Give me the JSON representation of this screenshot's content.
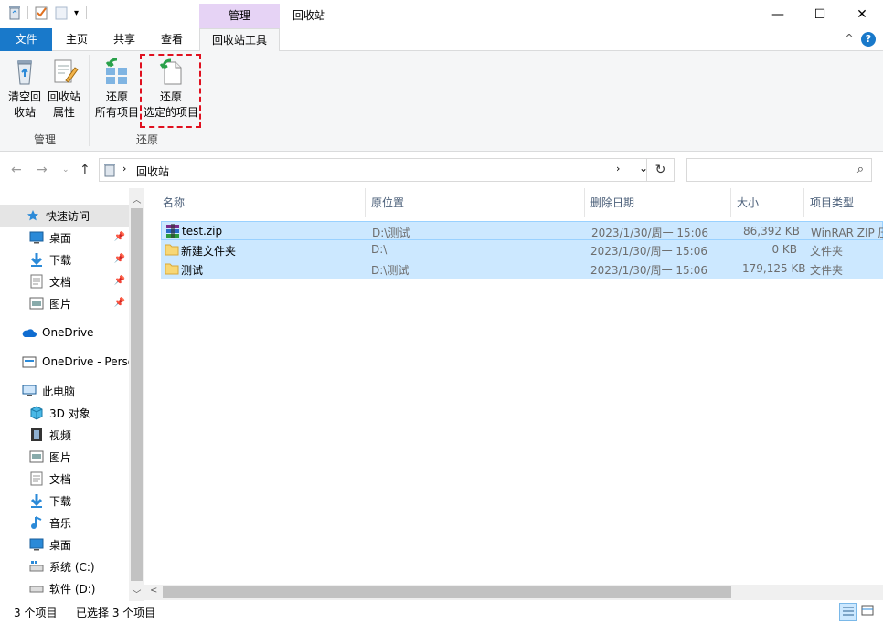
{
  "window": {
    "context_tab": "管理",
    "title": "回收站",
    "minimize": "—",
    "maximize": "☐",
    "close": "✕"
  },
  "ribbon_tabs": {
    "file": "文件",
    "home": "主页",
    "share": "共享",
    "view": "查看",
    "tools": "回收站工具",
    "collapse": "^",
    "help": "?"
  },
  "ribbon": {
    "empty_bin_l1": "清空回",
    "empty_bin_l2": "收站",
    "props_l1": "回收站",
    "props_l2": "属性",
    "group_manage": "管理",
    "restore_all_l1": "还原",
    "restore_all_l2": "所有项目",
    "restore_sel_l1": "还原",
    "restore_sel_l2": "选定的项目",
    "group_restore": "还原"
  },
  "address": {
    "path": "回收站",
    "search_placeholder": ""
  },
  "nav": {
    "quick_access": "快速访问",
    "desktop": "桌面",
    "downloads": "下载",
    "documents": "文档",
    "pictures": "图片",
    "onedrive": "OneDrive",
    "onedrive_personal": "OneDrive - Perso",
    "this_pc": "此电脑",
    "objects3d": "3D 对象",
    "videos": "视频",
    "pictures2": "图片",
    "documents2": "文档",
    "downloads2": "下载",
    "music": "音乐",
    "desktop2": "桌面",
    "drive_c": "系统 (C:)",
    "drive_d": "软件 (D:)"
  },
  "columns": {
    "name": "名称",
    "origin": "原位置",
    "deleted": "删除日期",
    "size": "大小",
    "type": "项目类型"
  },
  "files": [
    {
      "name": "test.zip",
      "origin": "D:\\测试",
      "deleted": "2023/1/30/周一 15:06",
      "size": "86,392 KB",
      "type": "WinRAR ZIP 压",
      "icon": "winrar-archive-icon"
    },
    {
      "name": "新建文件夹",
      "origin": "D:\\",
      "deleted": "2023/1/30/周一 15:06",
      "size": "0 KB",
      "type": "文件夹",
      "icon": "folder-icon"
    },
    {
      "name": "测试",
      "origin": "D:\\测试",
      "deleted": "2023/1/30/周一 15:06",
      "size": "179,125 KB",
      "type": "文件夹",
      "icon": "folder-icon"
    }
  ],
  "status": {
    "count": "3 个项目",
    "selected": "已选择 3 个项目"
  },
  "colors": {
    "accent": "#1979ca",
    "selection": "#cce8ff",
    "context_tab": "#e6d3f5",
    "highlight": "#e0101f"
  }
}
